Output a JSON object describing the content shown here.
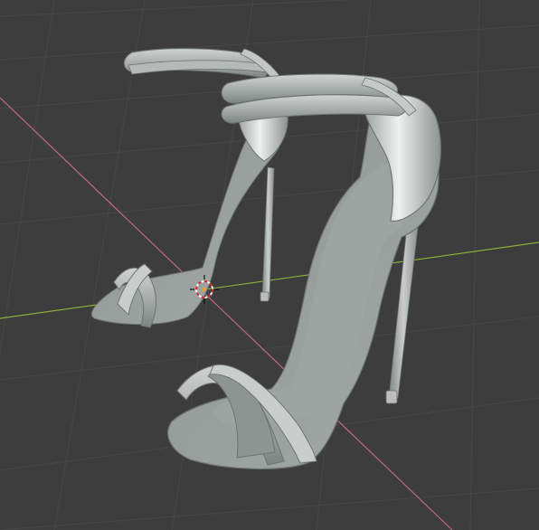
{
  "viewport": {
    "editor": "3D Viewport",
    "background_color": "#3d3d3d",
    "grid_color": "#474747",
    "x_axis_color": "#c06a7a",
    "y_axis_color": "#87b03b",
    "cursor_icon": "3d-cursor-icon",
    "model": {
      "description_icon": "high-heel-sandal-pair",
      "shoe_count": 2,
      "material_color": "#a4aaa8"
    }
  }
}
